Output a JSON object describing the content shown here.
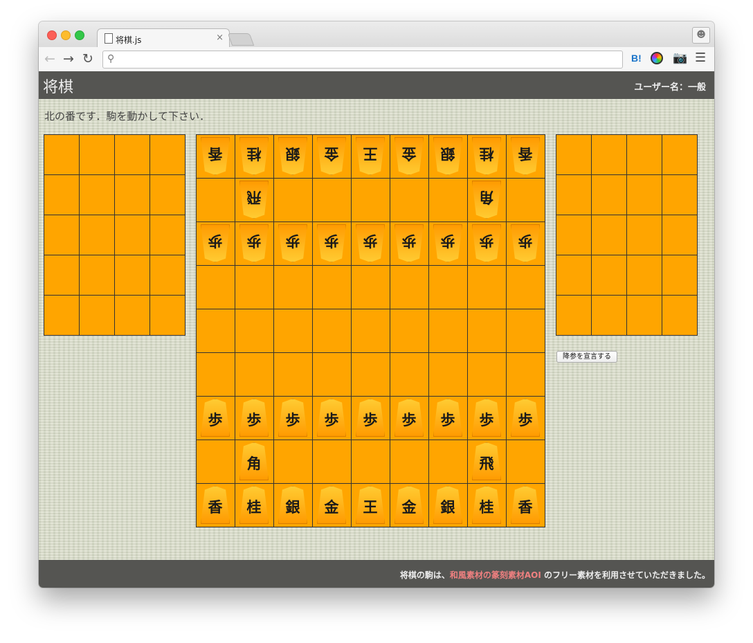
{
  "browser": {
    "tab_title": "将棋.js",
    "tab_close": "×",
    "address": "",
    "extensions": {
      "hatena": "B!"
    }
  },
  "page": {
    "title": "将棋",
    "user_label": "ユーザー名：一般",
    "status": "北の番です．駒を動かして下さい．",
    "resign_button": "降参を宣言する",
    "footer": {
      "before": "将棋の駒は、",
      "link": "和風素材の篆刻素材AOI",
      "after": " のフリー素材を利用させていただきました。"
    }
  },
  "hands": {
    "left": {
      "rows": 5,
      "cols": 4,
      "pieces": []
    },
    "right": {
      "rows": 5,
      "cols": 4,
      "pieces": []
    }
  },
  "board": {
    "rows": [
      [
        {
          "p": "香",
          "s": "gote"
        },
        {
          "p": "桂",
          "s": "gote"
        },
        {
          "p": "銀",
          "s": "gote"
        },
        {
          "p": "金",
          "s": "gote"
        },
        {
          "p": "王",
          "s": "gote"
        },
        {
          "p": "金",
          "s": "gote"
        },
        {
          "p": "銀",
          "s": "gote"
        },
        {
          "p": "桂",
          "s": "gote"
        },
        {
          "p": "香",
          "s": "gote"
        }
      ],
      [
        null,
        {
          "p": "飛",
          "s": "gote"
        },
        null,
        null,
        null,
        null,
        null,
        {
          "p": "角",
          "s": "gote"
        },
        null
      ],
      [
        {
          "p": "歩",
          "s": "gote"
        },
        {
          "p": "歩",
          "s": "gote"
        },
        {
          "p": "歩",
          "s": "gote"
        },
        {
          "p": "歩",
          "s": "gote"
        },
        {
          "p": "歩",
          "s": "gote"
        },
        {
          "p": "歩",
          "s": "gote"
        },
        {
          "p": "歩",
          "s": "gote"
        },
        {
          "p": "歩",
          "s": "gote"
        },
        {
          "p": "歩",
          "s": "gote"
        }
      ],
      [
        null,
        null,
        null,
        null,
        null,
        null,
        null,
        null,
        null
      ],
      [
        null,
        null,
        null,
        null,
        null,
        null,
        null,
        null,
        null
      ],
      [
        null,
        null,
        null,
        null,
        null,
        null,
        null,
        null,
        null
      ],
      [
        {
          "p": "歩",
          "s": "sente"
        },
        {
          "p": "歩",
          "s": "sente"
        },
        {
          "p": "歩",
          "s": "sente"
        },
        {
          "p": "歩",
          "s": "sente"
        },
        {
          "p": "歩",
          "s": "sente"
        },
        {
          "p": "歩",
          "s": "sente"
        },
        {
          "p": "歩",
          "s": "sente"
        },
        {
          "p": "歩",
          "s": "sente"
        },
        {
          "p": "歩",
          "s": "sente"
        }
      ],
      [
        null,
        {
          "p": "角",
          "s": "sente"
        },
        null,
        null,
        null,
        null,
        null,
        {
          "p": "飛",
          "s": "sente"
        },
        null
      ],
      [
        {
          "p": "香",
          "s": "sente"
        },
        {
          "p": "桂",
          "s": "sente"
        },
        {
          "p": "銀",
          "s": "sente"
        },
        {
          "p": "金",
          "s": "sente"
        },
        {
          "p": "王",
          "s": "sente"
        },
        {
          "p": "金",
          "s": "sente"
        },
        {
          "p": "銀",
          "s": "sente"
        },
        {
          "p": "桂",
          "s": "sente"
        },
        {
          "p": "香",
          "s": "sente"
        }
      ]
    ]
  },
  "colors": {
    "board": "#ffa500",
    "header_bg": "#555552",
    "credit_link": "#f08080",
    "page_bg": "#d9dcc8"
  },
  "icons": [
    "back-icon",
    "forward-icon",
    "reload-icon",
    "search-icon",
    "hatena-bookmark-icon",
    "color-picker-icon",
    "camera-icon",
    "menu-icon",
    "profile-icon",
    "document-icon"
  ]
}
